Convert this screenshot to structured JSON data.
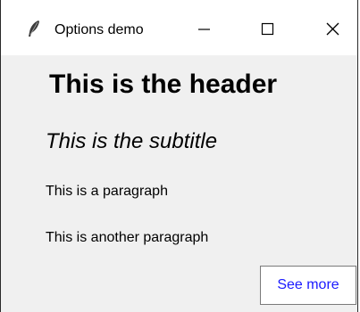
{
  "window": {
    "title": "Options demo",
    "app_icon": "feather-icon",
    "controls": {
      "minimize": "minimize-icon",
      "maximize": "maximize-icon",
      "close": "close-icon"
    }
  },
  "main": {
    "header": "This is the header",
    "subtitle": "This is the subtitle",
    "paragraphs": [
      "This is a paragraph",
      "This is another paragraph"
    ],
    "see_more_label": "See more"
  },
  "colors": {
    "content_background": "#f0f0f0",
    "titlebar_background": "#ffffff",
    "link_button_text": "#1a1aff"
  }
}
